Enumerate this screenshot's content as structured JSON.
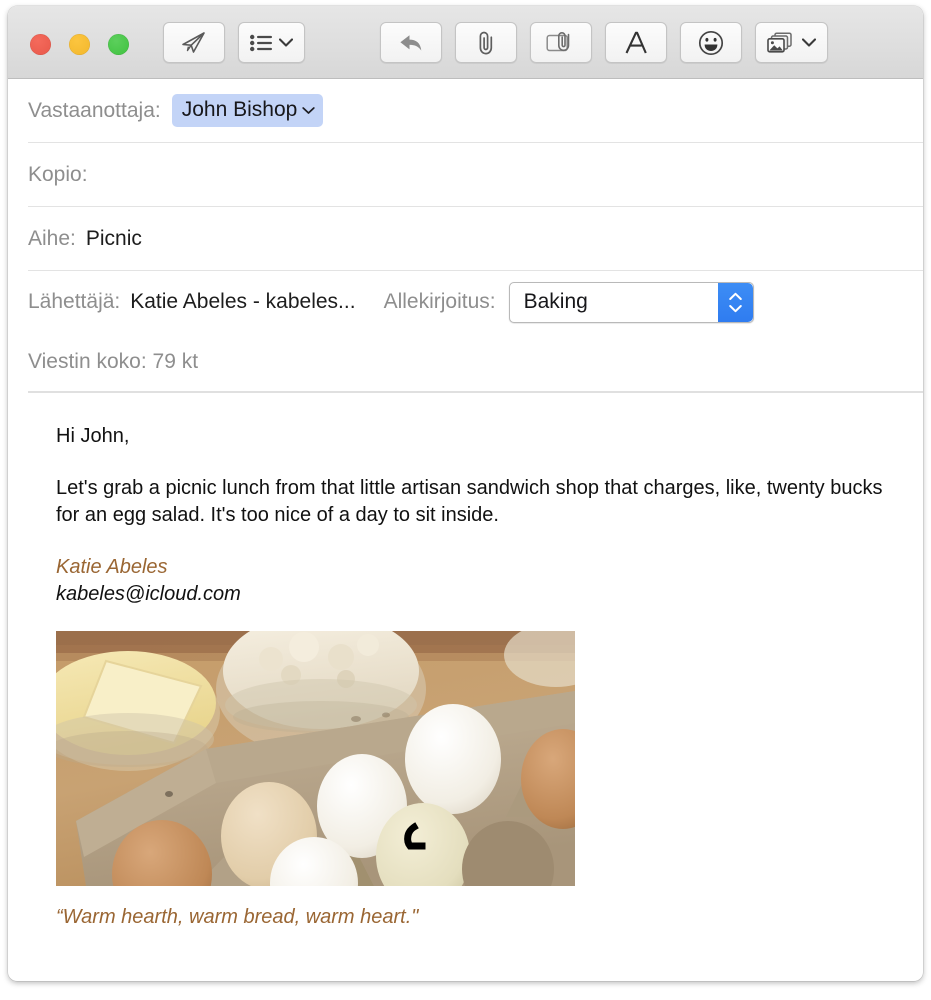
{
  "window": {
    "traffic_lights": [
      "close",
      "minimize",
      "maximize"
    ]
  },
  "toolbar": {
    "buttons": [
      {
        "name": "send-button",
        "icon": "paper-plane-icon",
        "chevron": false
      },
      {
        "name": "stationery-button",
        "icon": "list-icon",
        "chevron": true
      },
      {
        "name": "reply-button",
        "icon": "reply-arrow-icon",
        "chevron": false
      },
      {
        "name": "attach-button",
        "icon": "paperclip-icon",
        "chevron": false
      },
      {
        "name": "markup-button",
        "icon": "markup-attachment-icon",
        "chevron": false
      },
      {
        "name": "format-button",
        "icon": "letter-a-icon",
        "chevron": false
      },
      {
        "name": "emoji-button",
        "icon": "smiley-icon",
        "chevron": false
      },
      {
        "name": "photo-browser-button",
        "icon": "photos-icon",
        "chevron": true
      }
    ]
  },
  "header": {
    "to_label": "Vastaanottaja:",
    "to_token": "John Bishop",
    "cc_label": "Kopio:",
    "cc_value": "",
    "subject_label": "Aihe:",
    "subject_value": "Picnic",
    "from_label": "Lähettäjä:",
    "from_value": "Katie Abeles - kabeles...",
    "signature_label": "Allekirjoitus:",
    "signature_value": "Baking",
    "size_text": "Viestin koko: 79 kt"
  },
  "body": {
    "greeting": "Hi John,",
    "paragraph": "Let's grab a picnic lunch from that little artisan sandwich shop that charges, like, twenty bucks for an egg salad. It's too nice of a day to sit inside.",
    "signature_name": "Katie Abeles",
    "signature_email": "kabeles@icloud.com",
    "signature_quote": "“Warm hearth, warm bread, warm heart.\""
  },
  "photo": {
    "alt": "baking-ingredients-photo",
    "description": "Glass bowls of butter and flour beside a carton of eggs on a wooden table"
  },
  "colors": {
    "token_background": "#c3d4f7",
    "stepper_blue": "#3d8df5",
    "signature_brown": "#9a6633",
    "label_gray": "#8e8e8e",
    "toolbar_gray": "#dedede"
  }
}
